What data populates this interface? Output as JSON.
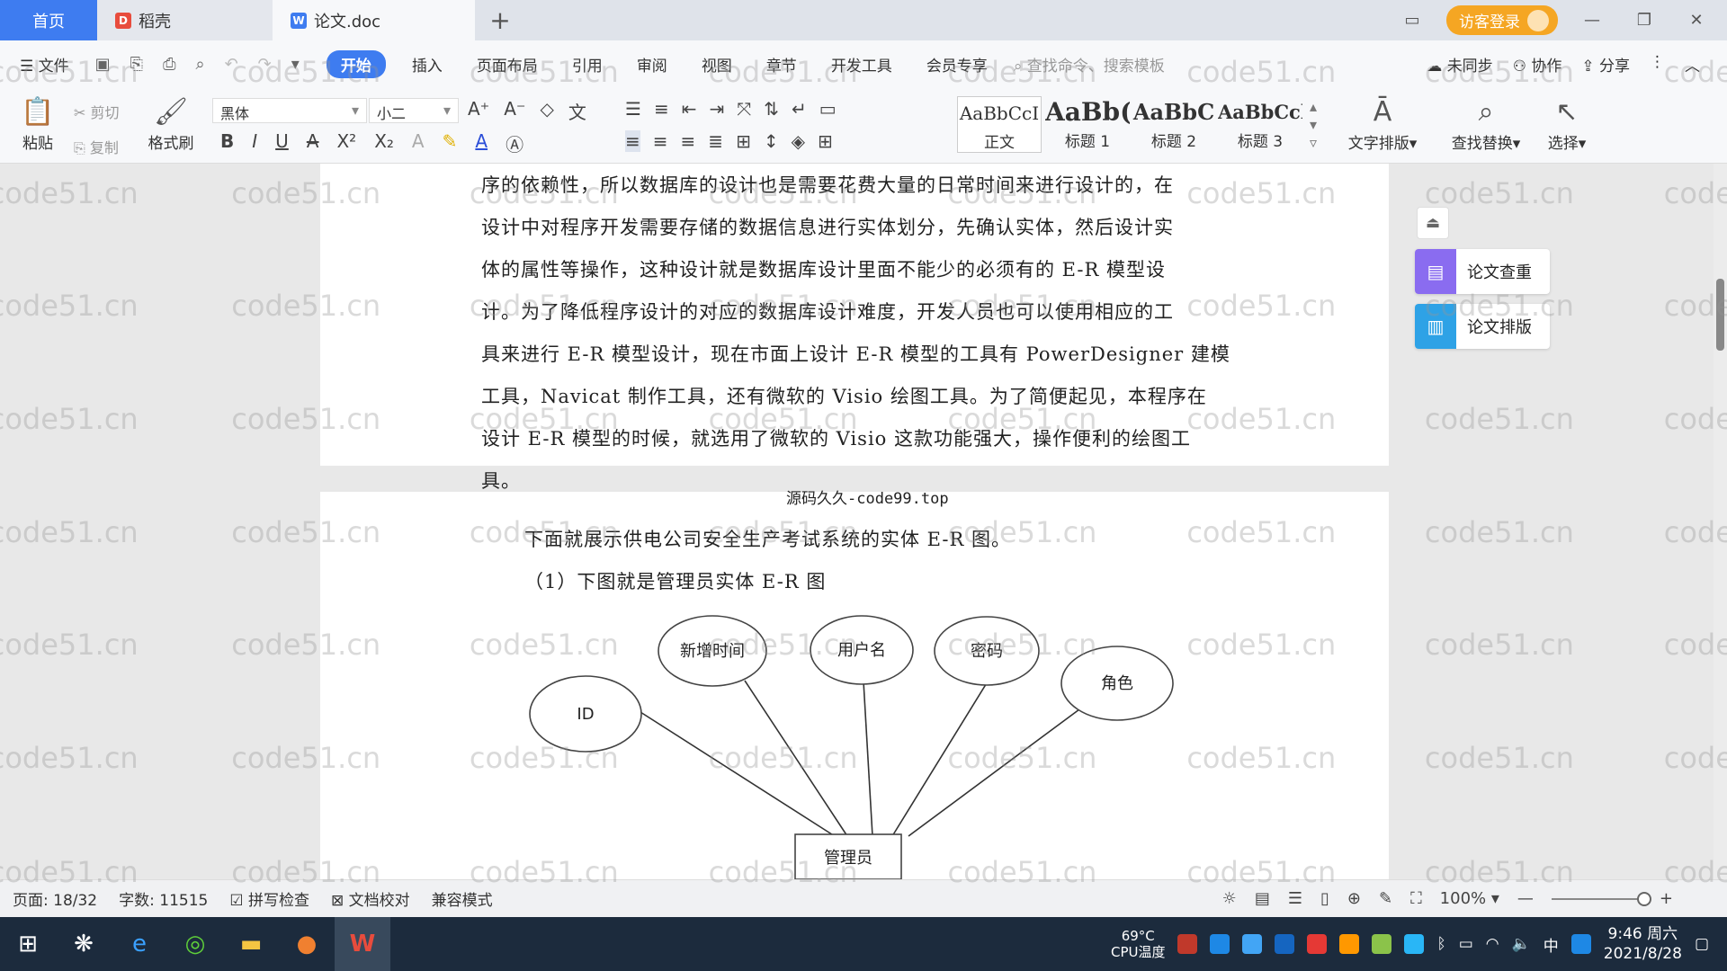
{
  "titlebar": {
    "home_tab": "首页",
    "tabs": [
      {
        "label": "稻壳",
        "icon": "daoke-icon"
      },
      {
        "label": "论文.doc",
        "icon": "wps-writer-icon"
      }
    ],
    "new_tab": "+",
    "login_label": "访客登录"
  },
  "menubar": {
    "file_label": "文件",
    "items": [
      "开始",
      "插入",
      "页面布局",
      "引用",
      "审阅",
      "视图",
      "章节",
      "开发工具",
      "会员专享"
    ],
    "active": "开始",
    "search_placeholder": "查找命令、搜索模板",
    "right": [
      "未同步",
      "协作",
      "分享"
    ]
  },
  "ribbon": {
    "paste": "粘贴",
    "cut": "剪切",
    "copy": "复制",
    "format_painter": "格式刷",
    "font_name": "黑体",
    "font_size": "小二",
    "styles": [
      {
        "sample": "AaBbCcI",
        "name": "正文"
      },
      {
        "sample": "AaBb(",
        "name": "标题 1"
      },
      {
        "sample": "AaBbC",
        "name": "标题 2"
      },
      {
        "sample": "AaBbCcl",
        "name": "标题 3"
      }
    ],
    "text_layout": "文字排版",
    "find_replace": "查找替换",
    "select": "选择"
  },
  "document": {
    "page1_lines": [
      "序的依赖性，所以数据库的设计也是需要花费大量的日常时间来进行设计的，在",
      "设计中对程序开发需要存储的数据信息进行实体划分，先确认实体，然后设计实",
      "体的属性等操作，这种设计就是数据库设计里面不能少的必须有的 E-R 模型设",
      "计。为了降低程序设计的对应的数据库设计难度，开发人员也可以使用相应的工",
      "具来进行 E-R 模型设计，现在市面上设计 E-R 模型的工具有 PowerDesigner 建模",
      "工具，Navicat 制作工具，还有微软的 Visio 绘图工具。为了简便起见，本程序在",
      "设计 E-R 模型的时候，就选用了微软的 Visio 这款功能强大，操作便利的绘图工",
      "具。"
    ],
    "overlay_text": "源码久久-code99.top",
    "page2_lines": [
      "下面就展示供电公司安全生产考试系统的实体 E-R 图。",
      "（1）下图就是管理员实体 E-R 图"
    ],
    "er_diagram": {
      "entity": "管理员",
      "attributes": [
        "ID",
        "新增时间",
        "用户名",
        "密码",
        "角色"
      ]
    }
  },
  "side_panel": {
    "check": "论文查重",
    "layout": "论文排版"
  },
  "statusbar": {
    "page": "页面: 18/32",
    "words": "字数: 11515",
    "spell": "拼写检查",
    "proof": "文档校对",
    "compat": "兼容模式",
    "zoom": "100%",
    "zoom_level_percent": 100
  },
  "taskbar": {
    "cpu_temp": "69°C",
    "cpu_label": "CPU温度",
    "ime": "中",
    "time": "9:46 周六",
    "date": "2021/8/28"
  },
  "watermark_text": "code51.cn",
  "colors": {
    "accent": "#3e7cf0",
    "login": "#f5a623",
    "taskbar": "#1c2b3d"
  }
}
